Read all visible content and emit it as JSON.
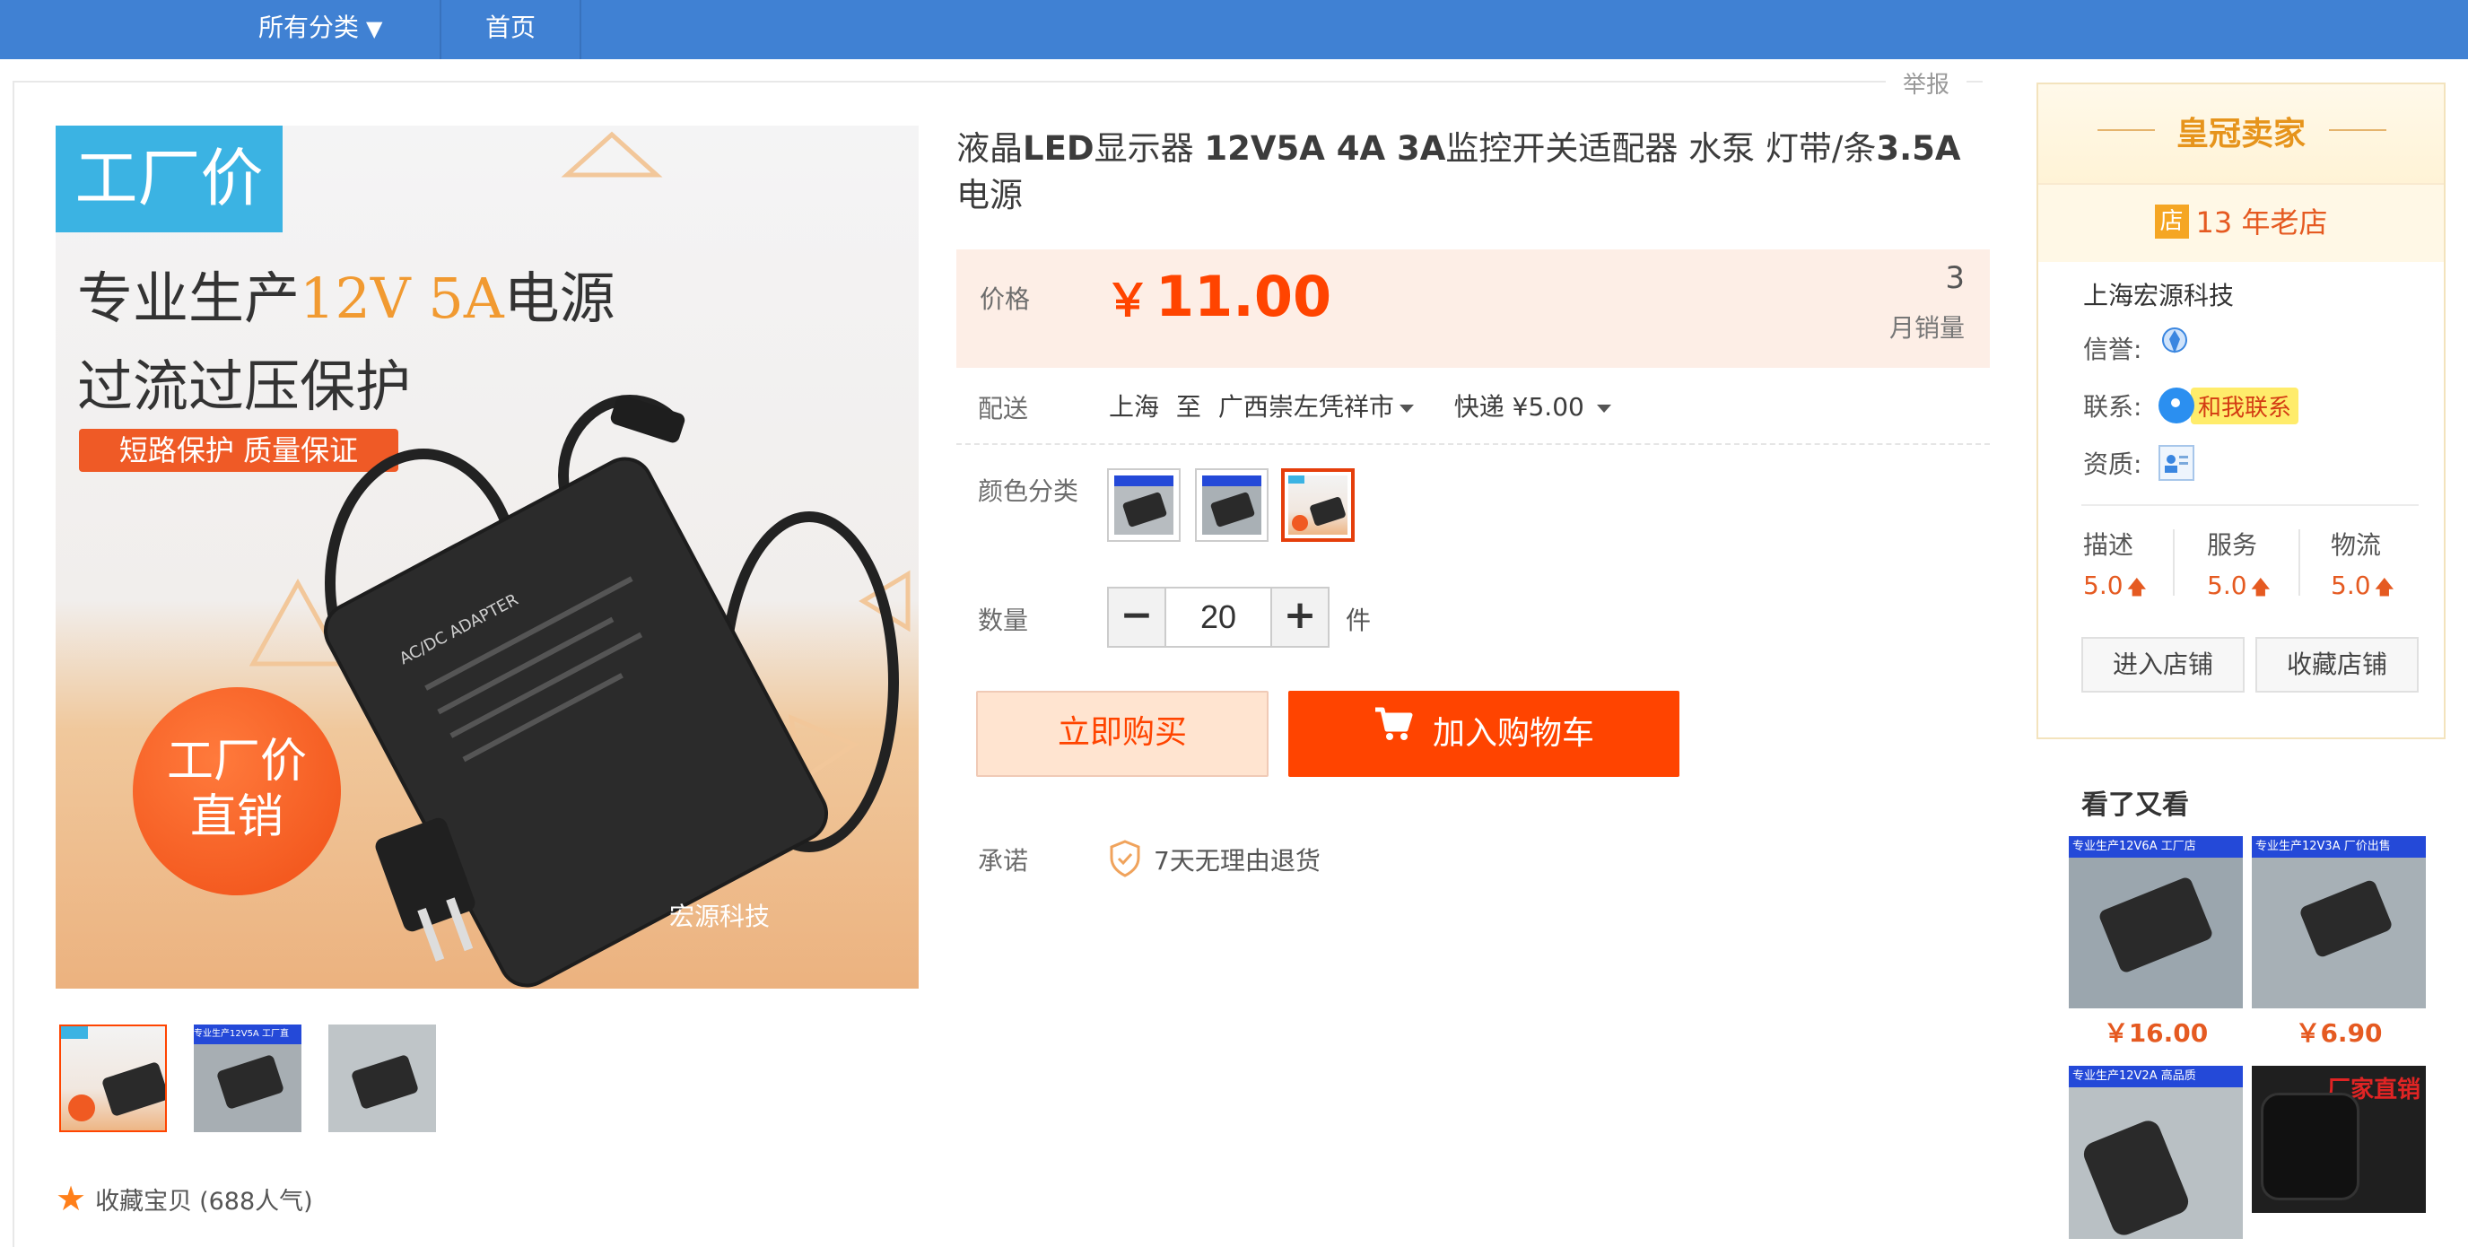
{
  "nav": {
    "all_categories": "所有分类",
    "home": "首页"
  },
  "report": "举报",
  "main_image": {
    "badge": "工厂价",
    "line1_a": "专业生产",
    "line1_b": "12V  5A",
    "line1_c": "电源",
    "line2": "过流过压保护",
    "tag": "短路保护 质量保证",
    "circle_1": "工厂价",
    "circle_2": "直销",
    "adapter_label": "AC/DC ADAPTER",
    "brand": "宏源科技"
  },
  "thumbnails": [
    {
      "name": "thumb-1"
    },
    {
      "name": "thumb-2",
      "strip": "专业生产12V5A 工厂直"
    },
    {
      "name": "thumb-3"
    }
  ],
  "favorite": {
    "label": "收藏宝贝",
    "count": "(688人气)"
  },
  "title": {
    "p1": "液晶",
    "p2": "LED",
    "p3": "显示器 ",
    "p4": "12V5A 4A 3A",
    "p5": "监控开关适配器 水泵 灯带/条",
    "p6": "3.5A",
    "p7": "电源"
  },
  "price": {
    "label": "价格",
    "currency": "￥",
    "value": "11.00",
    "monthly_sales": "3",
    "monthly_sales_label": "月销量"
  },
  "shipping": {
    "label": "配送",
    "from": "上海",
    "to_word": "至",
    "destination": "广西崇左凭祥市",
    "method": "快递 ¥5.00"
  },
  "color": {
    "label": "颜色分类",
    "selected_index": 2
  },
  "quantity": {
    "label": "数量",
    "value": "20",
    "minus": "−",
    "plus": "+",
    "unit": "件"
  },
  "buttons": {
    "buy_now": "立即购买",
    "add_to_cart": "加入购物车"
  },
  "promise": {
    "label": "承诺",
    "text": "7天无理由退货"
  },
  "seller": {
    "level_title": "皇冠卖家",
    "shop_icon_char": "店",
    "years": "13 年老店",
    "shop_name": "上海宏源科技",
    "credit_label": "信誉:",
    "contact_label": "联系:",
    "contact_text": "和我联系",
    "qualification_label": "资质:",
    "scores": [
      {
        "label": "描述",
        "value": "5.0"
      },
      {
        "label": "服务",
        "value": "5.0"
      },
      {
        "label": "物流",
        "value": "5.0"
      }
    ],
    "enter_shop": "进入店铺",
    "favorite_shop": "收藏店铺"
  },
  "also_viewed": {
    "title": "看了又看",
    "items": [
      {
        "strip": "专业生产12V6A 工厂店",
        "price": "￥16.00"
      },
      {
        "strip": "专业生产12V3A 厂价出售",
        "price": "￥6.90"
      },
      {
        "strip": "专业生产12V2A 高品质",
        "price": ""
      },
      {
        "strip": "厂家直销",
        "price": ""
      }
    ]
  },
  "colors": {
    "nav_bg": "#4081d3",
    "accent": "#ff4400",
    "price_bg": "#fdeee6",
    "crown": "#e6941c"
  }
}
